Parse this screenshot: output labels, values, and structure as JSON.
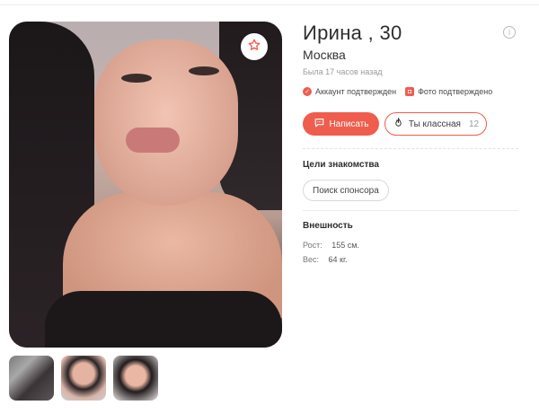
{
  "profile": {
    "name": "Ирина , 30",
    "city": "Москва",
    "last_seen": "Была 17 часов назад",
    "account_verified": "Аккаунт подтвержден",
    "photo_verified": "Фото подтверждено"
  },
  "actions": {
    "write_label": "Написать",
    "like_label": "Ты классная",
    "like_count": "12"
  },
  "goals": {
    "title": "Цели знакомства",
    "chips": [
      "Поиск спонсора"
    ]
  },
  "appearance": {
    "title": "Внешность",
    "height_label": "Рост:",
    "height_value": "155 см.",
    "weight_label": "Вес:",
    "weight_value": "64 кг."
  },
  "icons": {
    "favorite": "star-icon",
    "info": "info-icon",
    "write": "chat-icon",
    "like": "flame-icon",
    "account_verified": "check-icon",
    "photo_verified": "camera-icon"
  },
  "colors": {
    "accent": "#ef5d4d",
    "muted": "#9a9a9a"
  },
  "gallery": {
    "thumbnail_count": 3
  }
}
